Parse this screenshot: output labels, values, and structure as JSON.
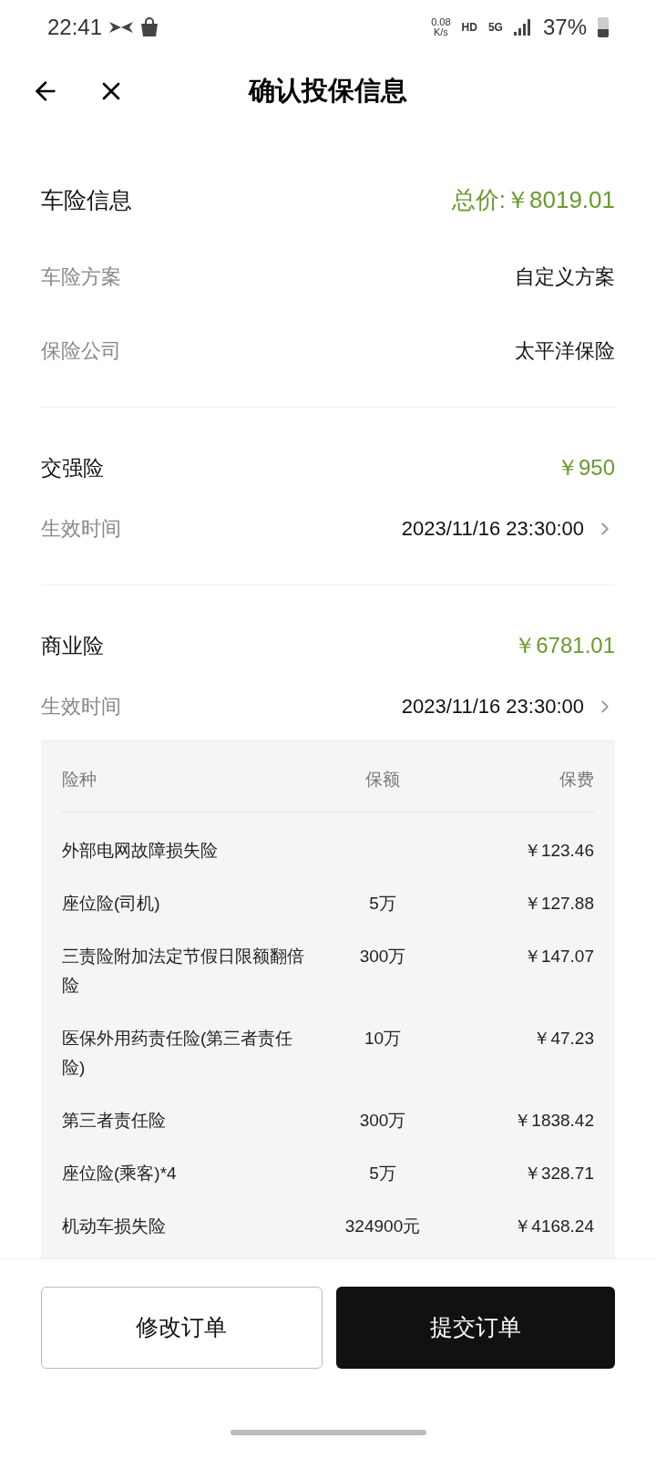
{
  "status_bar": {
    "time": "22:41",
    "speed_value": "0.08",
    "speed_unit": "K/s",
    "hd": "HD",
    "network": "5G",
    "battery": "37%"
  },
  "header": {
    "title": "确认投保信息"
  },
  "summary": {
    "title": "车险信息",
    "total": "总价:￥8019.01",
    "rows": [
      {
        "label": "车险方案",
        "value": "自定义方案"
      },
      {
        "label": "保险公司",
        "value": "太平洋保险"
      }
    ]
  },
  "compulsory": {
    "title": "交强险",
    "price": "￥950",
    "date_label": "生效时间",
    "date": "2023/11/16 23:30:00"
  },
  "commercial": {
    "title": "商业险",
    "price": "￥6781.01",
    "date_label": "生效时间",
    "date": "2023/11/16 23:30:00"
  },
  "table": {
    "columns": [
      "险种",
      "保额",
      "保费"
    ],
    "rows": [
      {
        "name": "外部电网故障损失险",
        "premium": "￥123.46"
      },
      {
        "name": "座位险(司机)",
        "amount": "5万",
        "premium": "￥127.88"
      },
      {
        "name": "三责险附加法定节假日限额翻倍险",
        "amount": "300万",
        "premium": "￥147.07"
      },
      {
        "name": "医保外用药责任险(第三者责任险)",
        "amount": "10万",
        "premium": "￥47.23"
      },
      {
        "name": "第三者责任险",
        "amount": "300万",
        "premium": "￥1838.42"
      },
      {
        "name": "座位险(乘客)*4",
        "amount": "5万",
        "premium": "￥328.71"
      },
      {
        "name": "机动车损失险",
        "amount": "324900元",
        "premium": "￥4168.24"
      }
    ]
  },
  "buttons": [
    {
      "label": "修改订单",
      "kind": "secondary"
    },
    {
      "label": "提交订单",
      "kind": "primary"
    }
  ]
}
